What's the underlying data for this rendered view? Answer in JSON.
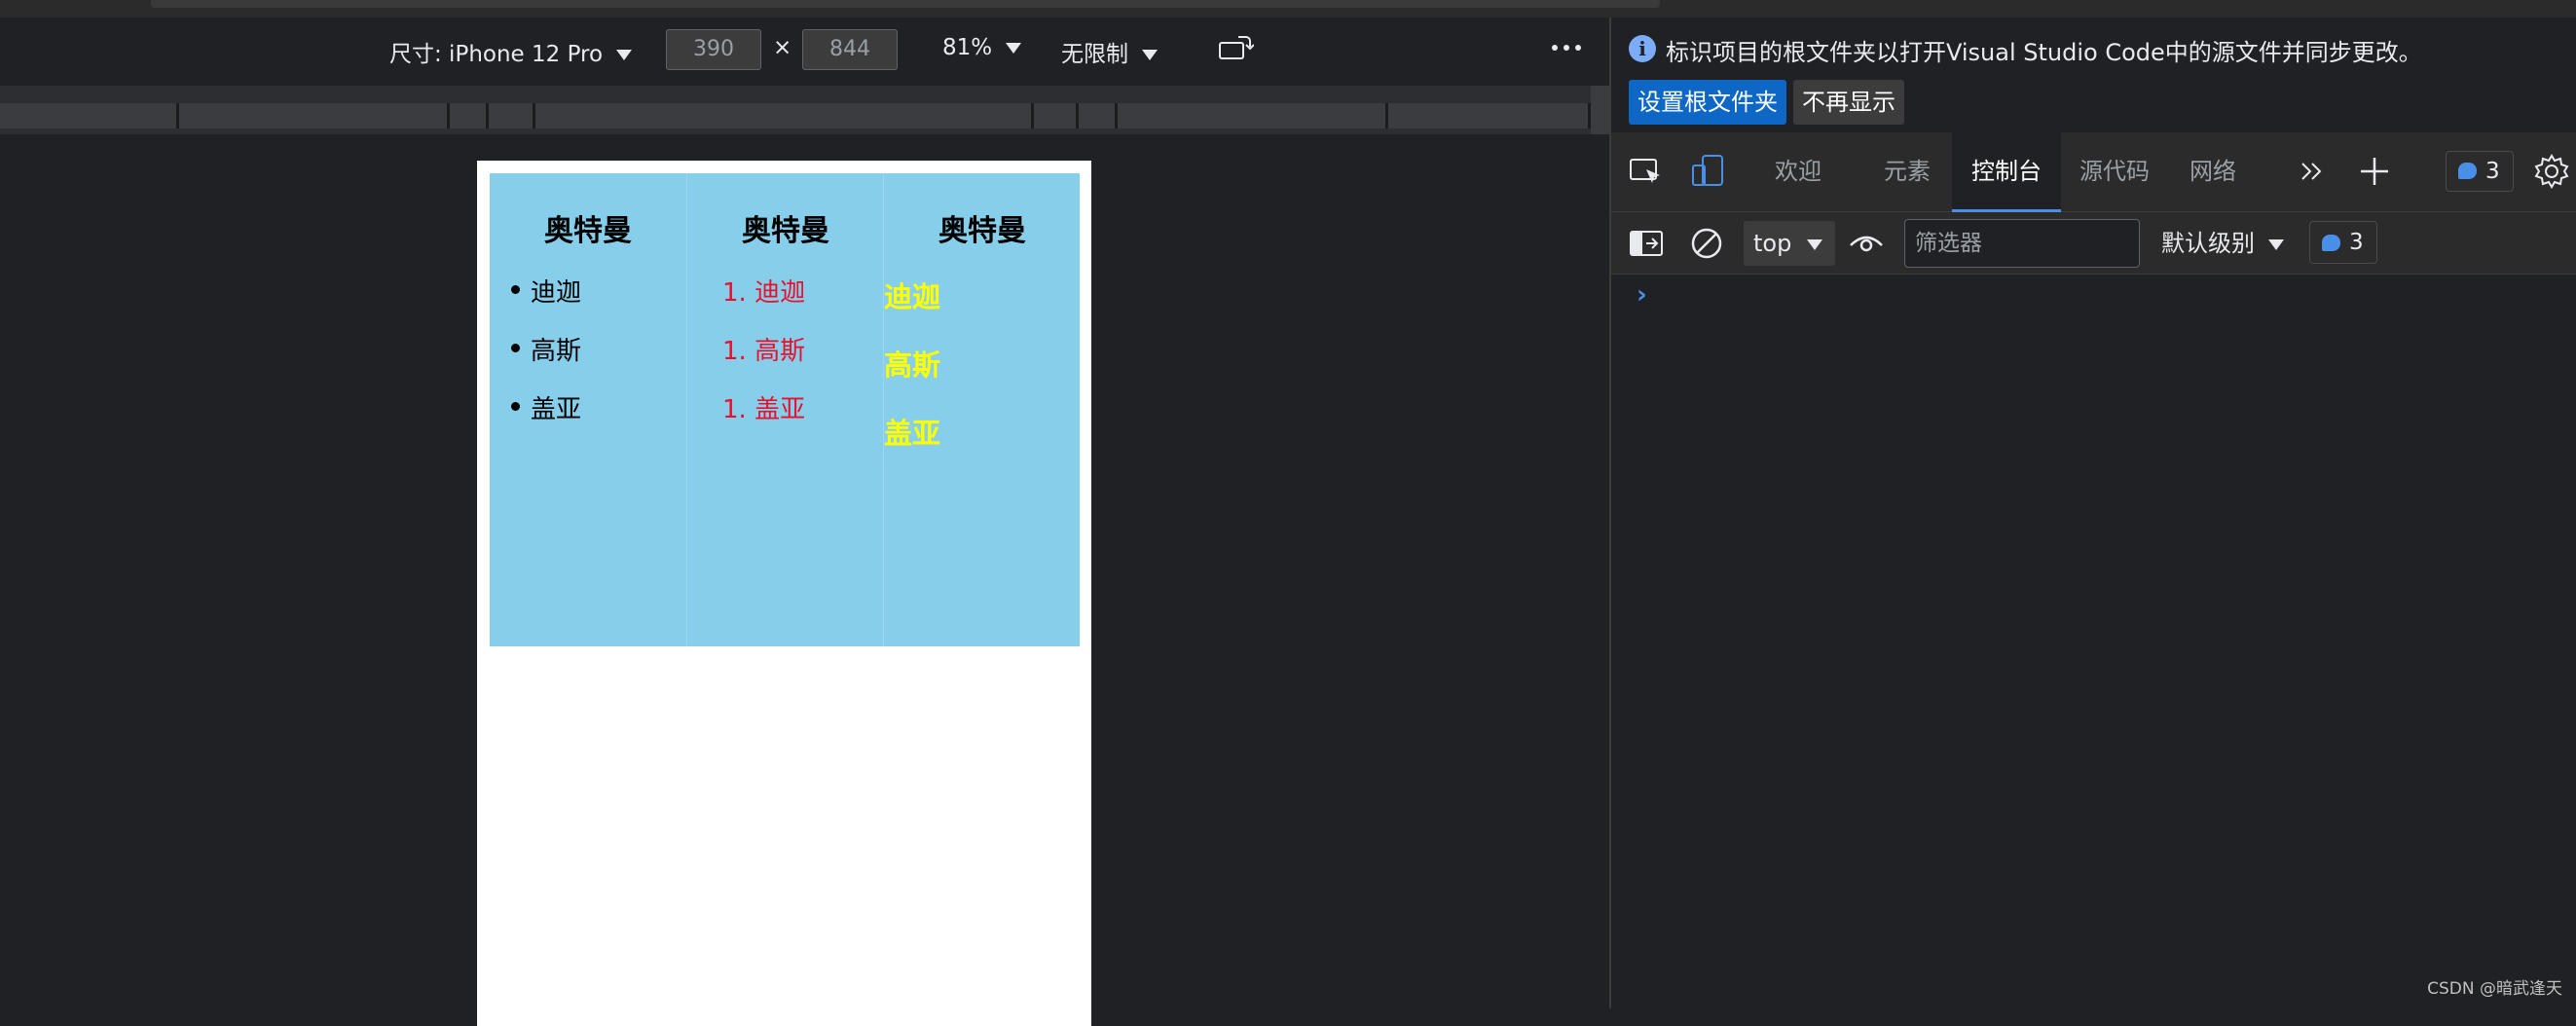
{
  "emulation": {
    "device_label": "尺寸: iPhone 12 Pro",
    "width_value": "390",
    "times": "×",
    "height_value": "844",
    "zoom": "81%",
    "throttle": "无限制",
    "more_icon": "more-horizontal-icon",
    "rotate_icon": "rotate-icon"
  },
  "page": {
    "columns": [
      {
        "heading": "奥特曼",
        "list_type": "ul",
        "items": [
          "迪迦",
          "高斯",
          "盖亚"
        ]
      },
      {
        "heading": "奥特曼",
        "list_type": "ol",
        "items": [
          "1. 迪迦",
          "1. 高斯",
          "1. 盖亚"
        ]
      },
      {
        "heading": "奥特曼",
        "list_type": "bold",
        "items": [
          "迪迦",
          "高斯",
          "盖亚"
        ]
      }
    ],
    "colors": {
      "background": "#87ceeb",
      "ol_text": "#e8112d",
      "bold_text": "#ffff00"
    }
  },
  "devtools": {
    "info": {
      "message": "标识项目的根文件夹以打开Visual Studio Code中的源文件并同步更改。",
      "primary_button": "设置根文件夹",
      "secondary_button": "不再显示"
    },
    "tabs": [
      "欢迎",
      "元素",
      "控制台",
      "源代码",
      "网络"
    ],
    "active_tab": "控制台",
    "issues_count": "3",
    "filter": {
      "context": "top",
      "placeholder": "筛选器",
      "level": "默认级别",
      "issues_count": "3"
    },
    "console_prompt": "›"
  },
  "watermark": "CSDN @暗武逢天"
}
